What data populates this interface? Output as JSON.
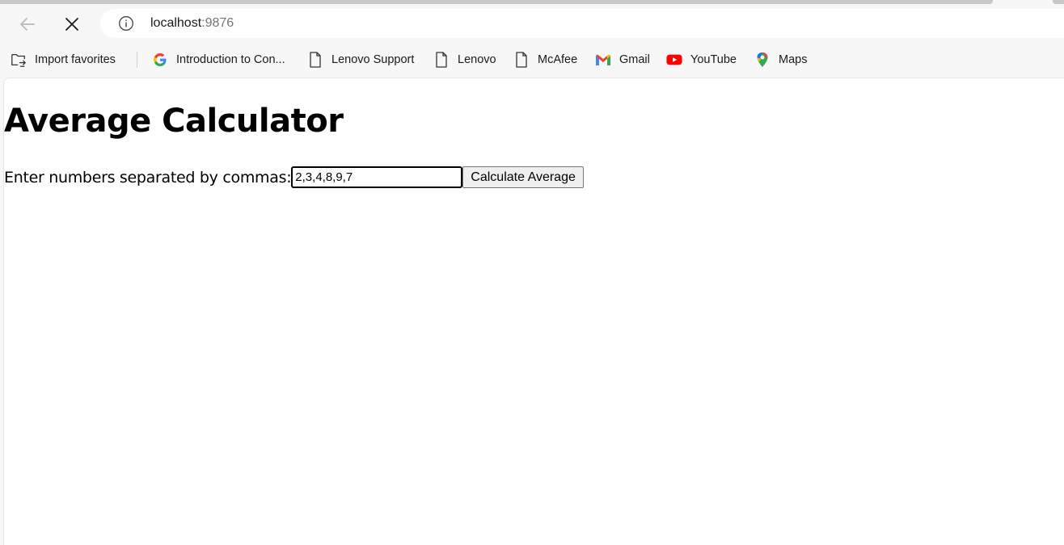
{
  "browser": {
    "url_host": "localhost",
    "url_port": ":9876"
  },
  "bookmarks": [
    {
      "label": "Import favorites",
      "icon": "import-favorites-icon"
    },
    {
      "label": "Introduction to Con...",
      "icon": "google-icon"
    },
    {
      "label": "Lenovo Support",
      "icon": "page-icon"
    },
    {
      "label": "Lenovo",
      "icon": "page-icon"
    },
    {
      "label": "McAfee",
      "icon": "page-icon"
    },
    {
      "label": "Gmail",
      "icon": "gmail-icon"
    },
    {
      "label": "YouTube",
      "icon": "youtube-icon"
    },
    {
      "label": "Maps",
      "icon": "maps-icon"
    }
  ],
  "page": {
    "title": "Average Calculator",
    "label": "Enter numbers separated by commas:",
    "input_value": "2,3,4,8,9,7",
    "button_label": "Calculate Average"
  },
  "colors": {
    "youtube": "#ff0000",
    "gmail_red": "#ea4335",
    "maps_blue": "#4285f4"
  }
}
